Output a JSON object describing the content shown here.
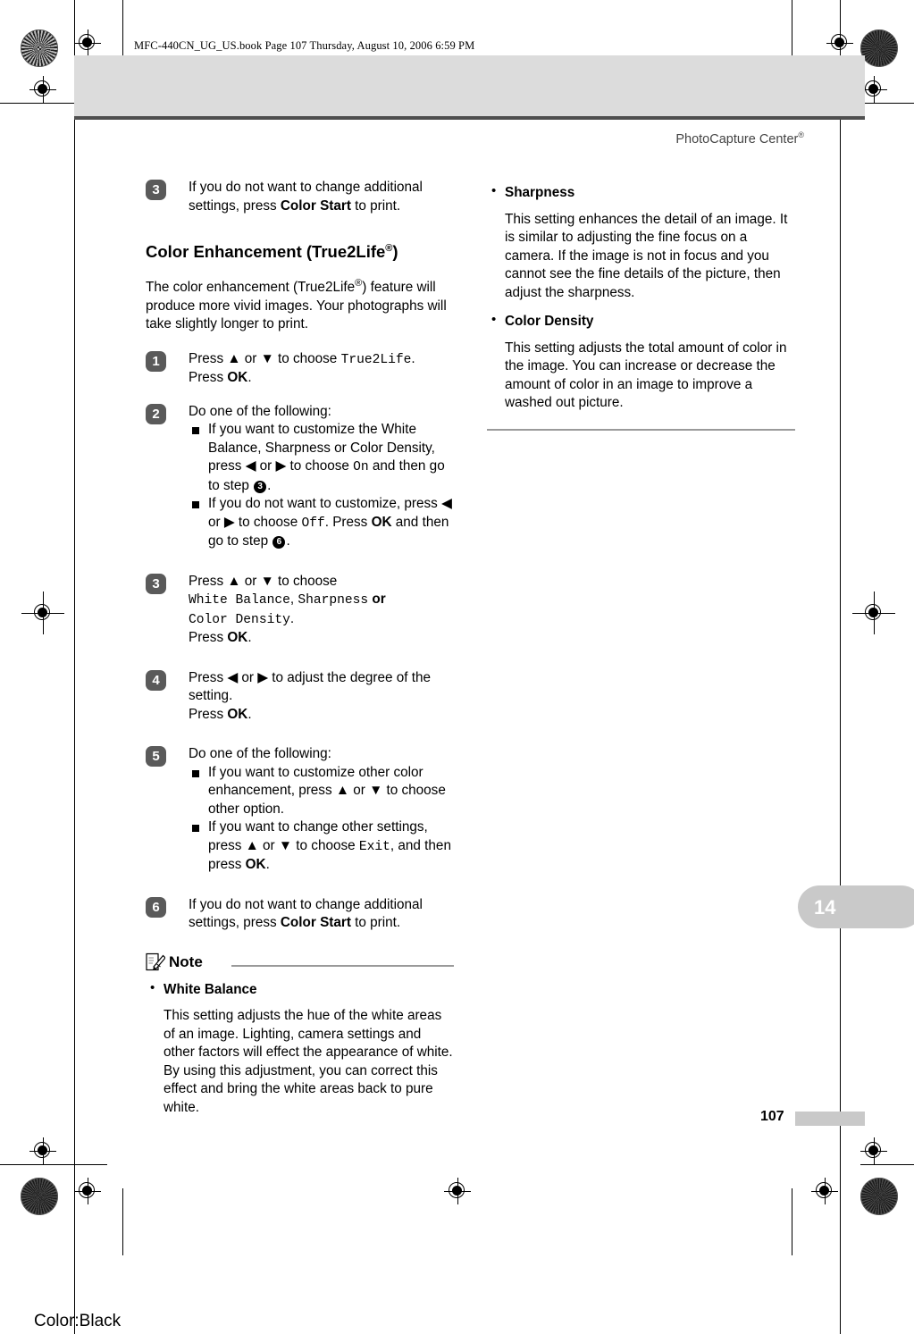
{
  "prepress": {
    "file_header": "MFC-440CN_UG_US.book  Page 107  Thursday, August 10, 2006  6:59 PM",
    "color_label": "Color:Black"
  },
  "running_head": {
    "title": "PhotoCapture Center",
    "superscript": "®"
  },
  "chapter_tab": {
    "number": "14"
  },
  "folio": {
    "page_number": "107"
  },
  "left_column": {
    "step_3_top": {
      "badge": "3",
      "text_before": "If you do not want to change additional settings, press ",
      "bold": "Color Start",
      "text_after": " to print."
    },
    "heading": {
      "text_a": "Color Enhancement (True2Life",
      "sup": "®",
      "text_b": ")"
    },
    "intro": {
      "text_a": "The color enhancement (True2Life",
      "sup": "®",
      "text_b": ") feature will produce more vivid images. Your photographs will take slightly longer to print."
    },
    "step_1": {
      "badge": "1",
      "line1_a": "Press ▲ or ▼ to choose ",
      "line1_lcd": "True2Life",
      "line1_b": ".",
      "line2_a": "Press ",
      "line2_bold": "OK",
      "line2_b": "."
    },
    "step_2": {
      "badge": "2",
      "lead": "Do one of the following:",
      "bullet_1_a": "If you want to customize the White Balance, Sharpness or Color Density, press ◀ or ▶ to choose ",
      "bullet_1_lcd": "On",
      "bullet_1_b": " and then go to step ",
      "bullet_1_ref": "3",
      "bullet_1_c": ".",
      "bullet_2_a": "If you do not want to customize, press ◀ or ▶ to choose ",
      "bullet_2_lcd": "Off",
      "bullet_2_b": ". Press ",
      "bullet_2_bold": "OK",
      "bullet_2_c": " and then go to step ",
      "bullet_2_ref": "6",
      "bullet_2_d": "."
    },
    "step_3": {
      "badge": "3",
      "line1": "Press ▲ or ▼ to choose",
      "lcd_1": "White Balance",
      "sep_1": ", ",
      "lcd_2": "Sharpness",
      "sep_2": " or ",
      "lcd_3": "Color Density",
      "sep_3": ".",
      "line3_a": "Press ",
      "line3_bold": "OK",
      "line3_b": "."
    },
    "step_4": {
      "badge": "4",
      "line1": "Press ◀ or ▶ to adjust the degree of the setting.",
      "line2_a": "Press ",
      "line2_bold": "OK",
      "line2_b": "."
    },
    "step_5": {
      "badge": "5",
      "lead": "Do one of the following:",
      "bullet_1": "If you want to customize other color enhancement, press ▲ or ▼ to choose other option.",
      "bullet_2_a": "If you want to change other settings, press ▲ or ▼ to choose ",
      "bullet_2_lcd": "Exit",
      "bullet_2_b": ", and then press ",
      "bullet_2_bold": "OK",
      "bullet_2_c": "."
    },
    "step_6": {
      "badge": "6",
      "text_before": "If you do not want to change additional settings, press ",
      "bold": "Color Start",
      "text_after": " to print."
    },
    "note": {
      "title": "Note",
      "bullet_title": "White Balance",
      "bullet_body": "This setting adjusts the hue of the white areas of an image. Lighting, camera settings and other factors will effect the appearance of white. By using this adjustment, you can correct this effect and bring the white areas back to pure white."
    }
  },
  "right_column": {
    "sharpness": {
      "title": "Sharpness",
      "body": "This setting enhances the detail of an image. It is similar to adjusting the fine focus on a camera. If the image is not in focus and you cannot see the fine details of the picture, then adjust the sharpness."
    },
    "color_density": {
      "title": "Color Density",
      "body": "This setting adjusts the total amount of color in the image. You can increase or decrease the amount of color in an image to improve a washed out picture."
    }
  }
}
